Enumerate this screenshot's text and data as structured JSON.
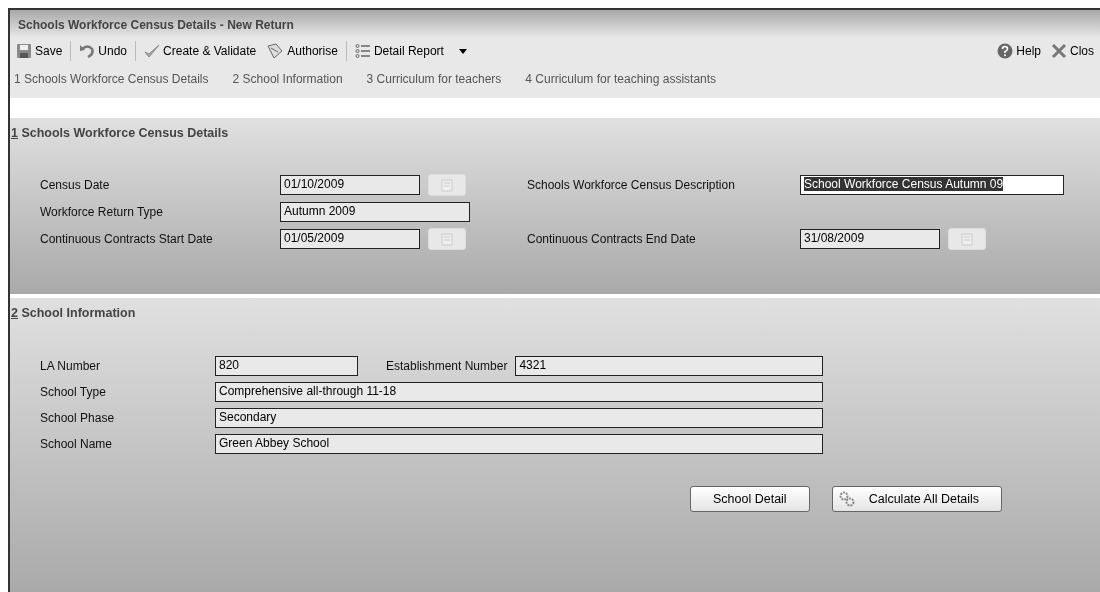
{
  "window": {
    "title": "Schools Workforce Census Details - New Return"
  },
  "toolbar": {
    "left": [
      {
        "kind": "save",
        "label": "Save"
      },
      {
        "kind": "undo",
        "label": "Undo"
      },
      {
        "kind": "validate",
        "label": "Create & Validate"
      },
      {
        "kind": "authorise",
        "label": "Authorise"
      },
      {
        "kind": "report",
        "label": "Detail Report"
      }
    ],
    "right": [
      {
        "kind": "help",
        "label": "Help"
      },
      {
        "kind": "close",
        "label": "Clos"
      }
    ]
  },
  "nav": [
    "1 Schools Workforce Census Details",
    "2 School Information",
    "3 Curriculum for teachers",
    "4 Curriculum for teaching assistants"
  ],
  "census_section": {
    "number": "1",
    "title": " Schools Workforce Census Details",
    "census_date": {
      "label": "Census Date",
      "value": "01/10/2009",
      "editable": false
    },
    "description": {
      "label": "Schools Workforce Census Description",
      "value": "School Workforce Census Autumn 09",
      "editable": true,
      "selected": true
    },
    "return_type": {
      "label": "Workforce Return Type",
      "value": "Autumn 2009",
      "editable": false
    },
    "start_date": {
      "label": "Continuous Contracts Start Date",
      "value": "01/05/2009",
      "editable": false
    },
    "end_date": {
      "label": "Continuous Contracts End Date",
      "value": "31/08/2009",
      "editable": false
    }
  },
  "school_section": {
    "number": "2",
    "title": " School Information",
    "la_number": {
      "label": "LA Number",
      "value": "820"
    },
    "establishment_number": {
      "label": "Establishment Number",
      "value": "4321"
    },
    "school_type": {
      "label": "School Type",
      "value": "Comprehensive all-through 11-18"
    },
    "school_phase": {
      "label": "School Phase",
      "value": "Secondary"
    },
    "school_name": {
      "label": "School Name",
      "value": "Green Abbey School"
    },
    "buttons": [
      {
        "kind": "plain",
        "label": "School Detail"
      },
      {
        "kind": "gears",
        "label": "Calculate All Details"
      }
    ]
  }
}
